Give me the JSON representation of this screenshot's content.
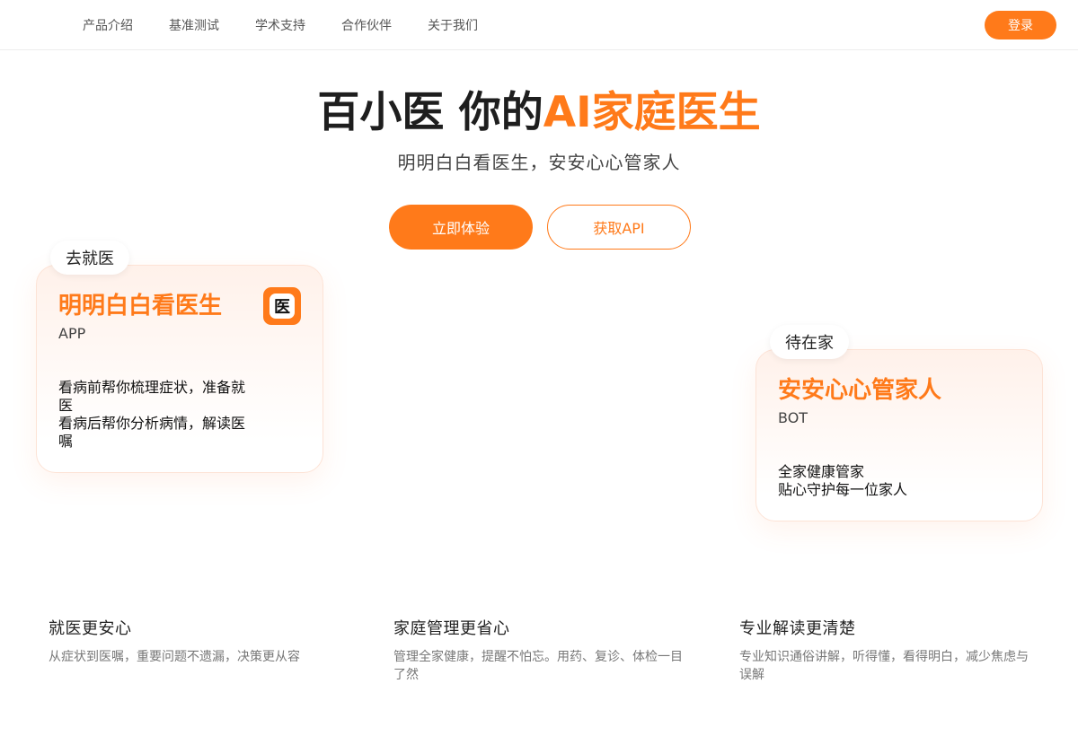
{
  "nav": {
    "links": [
      "产品介绍",
      "基准测试",
      "学术支持",
      "合作伙伴",
      "关于我们"
    ],
    "login_label": "登录"
  },
  "hero": {
    "title_main": "百小医 你的",
    "title_accent": "AI家庭医生",
    "subtitle": "明明白白看医生，安安心心管家人",
    "primary_cta": "立即体验",
    "secondary_cta": "获取API"
  },
  "cards": {
    "left": {
      "tab": "去就医",
      "title": "明明白白看医生",
      "kind": "APP",
      "icon_glyph": "医",
      "lines": [
        "看病前帮你梳理症状，准备就医",
        "看病后帮你分析病情，解读医嘱"
      ]
    },
    "right": {
      "tab": "待在家",
      "title": "安安心心管家人",
      "kind": "BOT",
      "lines": [
        "全家健康管家",
        "贴心守护每一位家人"
      ]
    }
  },
  "benefits": [
    {
      "title": "就医更安心",
      "desc": "从症状到医嘱，重要问题不遗漏，决策更从容"
    },
    {
      "title": "家庭管理更省心",
      "desc": "管理全家健康，提醒不怕忘。用药、复诊、体检一目了然"
    },
    {
      "title": "专业解读更清楚",
      "desc": "专业知识通俗讲解，听得懂，看得明白，减少焦虑与误解"
    }
  ],
  "colors": {
    "accent": "#ff7a1a",
    "text_dark": "#1e1e1e",
    "text_muted": "#777777"
  }
}
